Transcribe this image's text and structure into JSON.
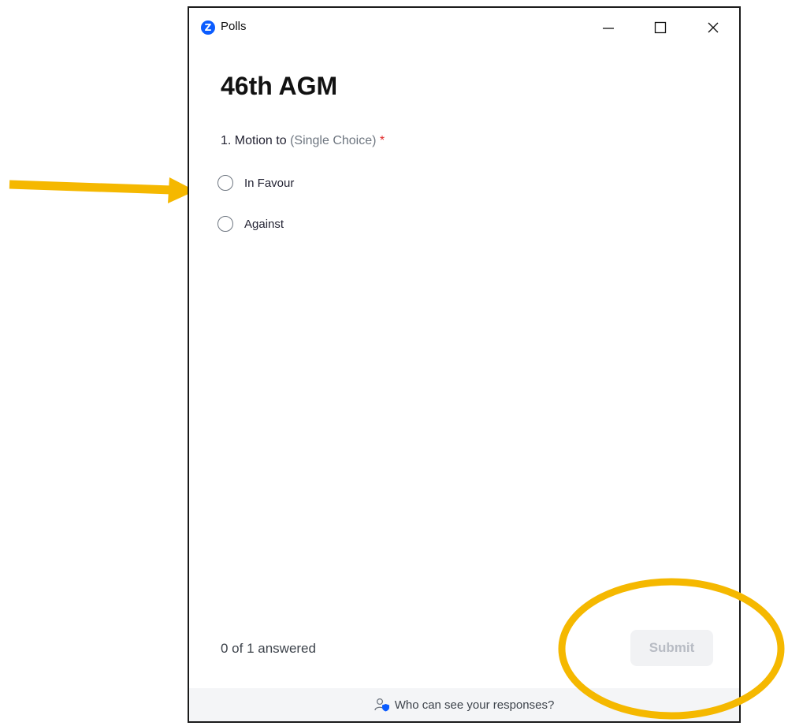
{
  "window": {
    "app_name": "Polls",
    "logo_letter": "Z",
    "controls": {
      "minimize_icon": "minimize-icon",
      "maximize_icon": "maximize-icon",
      "close_icon": "close-icon"
    }
  },
  "poll": {
    "title": "46th AGM",
    "question": {
      "number_text": "1. Motion to",
      "type_text": "(Single Choice)",
      "required_mark": "*"
    },
    "options": [
      {
        "label": "In Favour",
        "selected": false
      },
      {
        "label": "Against",
        "selected": false
      }
    ]
  },
  "footer": {
    "progress_text": "0 of 1 answered",
    "submit_label": "Submit",
    "submit_enabled": false,
    "privacy_link": "Who can see your responses?",
    "privacy_icon": "user-shield-icon"
  },
  "annotations": {
    "arrow_color": "#f5b800",
    "circle_color": "#f5b800"
  },
  "colors": {
    "brand": "#0b5cff",
    "required": "#e02828",
    "submit_disabled_bg": "#f1f2f4",
    "submit_disabled_text": "#b8bcc4"
  }
}
